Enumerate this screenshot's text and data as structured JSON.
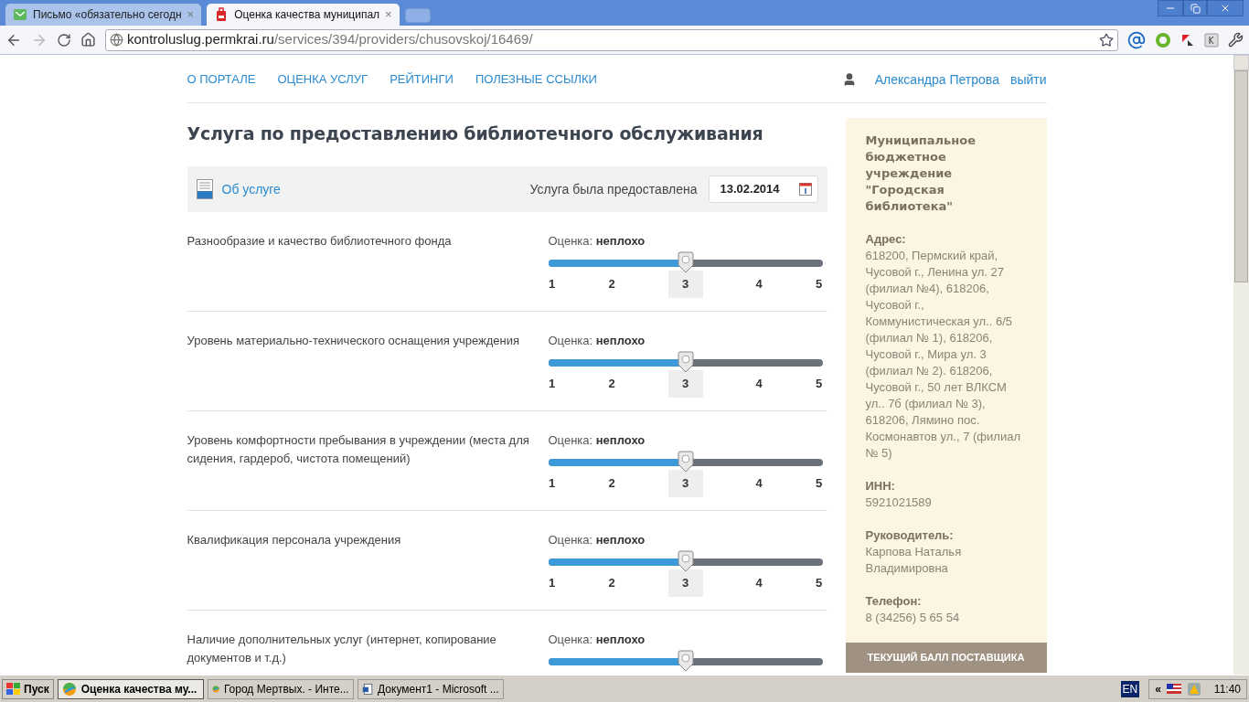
{
  "browser": {
    "tabs": [
      {
        "title": "Письмо «обязательно сегодн",
        "close": "×",
        "selected": false,
        "kind": "mail"
      },
      {
        "title": "Оценка качества муниципал",
        "close": "×",
        "selected": true,
        "kind": "site"
      }
    ],
    "address": {
      "host": "kontroluslug.permkrai.ru",
      "path": "/services/394/providers/chusovskoj/16469/"
    }
  },
  "nav": {
    "items": [
      "О ПОРТАЛЕ",
      "ОЦЕНКА УСЛУГ",
      "РЕЙТИНГИ",
      "ПОЛЕЗНЫЕ ССЫЛКИ"
    ],
    "user": "Александра Петрова",
    "logout": "выйти"
  },
  "title": "Услуга по предоставлению библиотечного обслуживания",
  "info_bar": {
    "about_link": "Об услуге",
    "date_label": "Услуга была предоставлена",
    "date": "13.02.2014"
  },
  "criteria": [
    {
      "label": "Разнообразие и качество библиотечного фонда",
      "rating_label": "Оценка:",
      "rating": "неплохо",
      "level": 0.5,
      "ticks": [
        {
          "label": "1",
          "selected": false
        },
        {
          "label": "2",
          "selected": false
        },
        {
          "label": "3",
          "selected": true
        },
        {
          "label": "4",
          "selected": false
        },
        {
          "label": "5",
          "selected": false
        }
      ]
    },
    {
      "label": "Уровень материально-технического оснащения учреждения",
      "rating_label": "Оценка:",
      "rating": "неплохо",
      "level": 0.5,
      "ticks": [
        {
          "label": "1",
          "selected": false
        },
        {
          "label": "2",
          "selected": false
        },
        {
          "label": "3",
          "selected": true
        },
        {
          "label": "4",
          "selected": false
        },
        {
          "label": "5",
          "selected": false
        }
      ]
    },
    {
      "label": "Уровень комфортности пребывания в учреждении (места для сидения, гардероб, чистота помещений)",
      "rating_label": "Оценка:",
      "rating": "неплохо",
      "level": 0.5,
      "ticks": [
        {
          "label": "1",
          "selected": false
        },
        {
          "label": "2",
          "selected": false
        },
        {
          "label": "3",
          "selected": true
        },
        {
          "label": "4",
          "selected": false
        },
        {
          "label": "5",
          "selected": false
        }
      ]
    },
    {
      "label": "Квалификация персонала учреждения",
      "rating_label": "Оценка:",
      "rating": "неплохо",
      "level": 0.5,
      "ticks": [
        {
          "label": "1",
          "selected": false
        },
        {
          "label": "2",
          "selected": false
        },
        {
          "label": "3",
          "selected": true
        },
        {
          "label": "4",
          "selected": false
        },
        {
          "label": "5",
          "selected": false
        }
      ]
    },
    {
      "label": "Наличие дополнительных услуг (интернет, копирование документов и т.д.)",
      "rating_label": "Оценка:",
      "rating": "неплохо",
      "level": 0.5
    }
  ],
  "provider": {
    "name": "Муниципальное бюджетное учреждение \"Городская библиотека\"",
    "fields": [
      {
        "label": "Адрес:",
        "value": "618200, Пермский край, Чусовой г., Ленина ул. 27 (филиал №4), 618206, Чусовой г., Коммунистическая ул.. 6/5 (филиал № 1), 618206, Чусовой г., Мира ул. 3 (филиал № 2). 618206, Чусовой г., 50 лет ВЛКСМ ул.. 7б (филиал № 3), 618206, Лямино пос. Космонавтов ул., 7 (филиал № 5)"
      },
      {
        "label": "ИНН:",
        "value": "5921021589"
      },
      {
        "label": "Руководитель:",
        "value": "Карпова Наталья Владимировна"
      },
      {
        "label": "Телефон:",
        "value": "8 (34256) 5 65 54"
      }
    ],
    "score_bar": "ТЕКУЩИЙ БАЛЛ ПОСТАВЩИКА"
  },
  "taskbar": {
    "start": "Пуск",
    "tasks": [
      {
        "title": "Оценка качества му...",
        "selected": true,
        "kind": "browser"
      },
      {
        "title": "Город Мертвых. - Инте...",
        "selected": false,
        "kind": "browser"
      },
      {
        "title": "Документ1 - Microsoft ...",
        "selected": false,
        "kind": "word"
      }
    ],
    "lang": "EN",
    "expand": "«",
    "time": "11:40"
  }
}
